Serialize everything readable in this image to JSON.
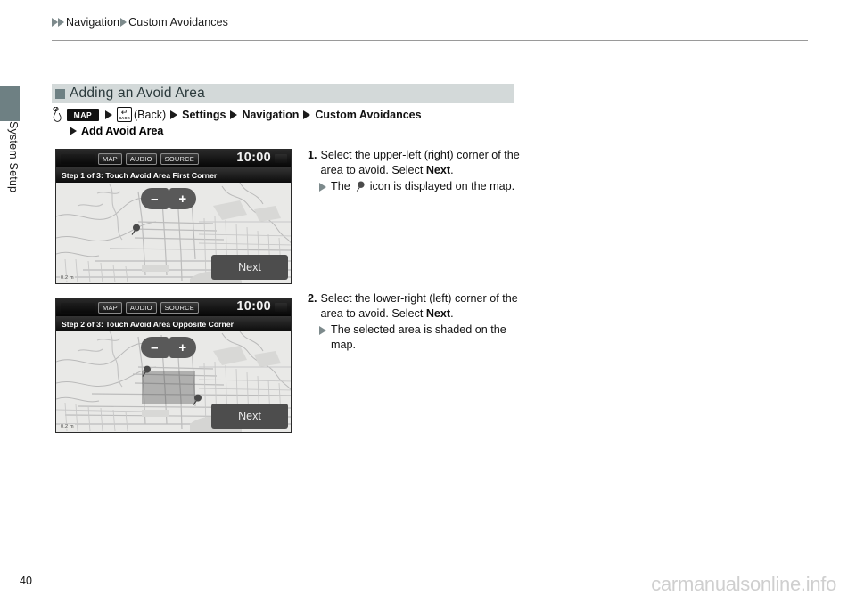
{
  "breadcrumb": {
    "items": [
      "Navigation",
      "Custom Avoidances"
    ]
  },
  "sidebar": {
    "tab_label": "System Setup"
  },
  "section": {
    "heading": "Adding an Avoid Area",
    "accent_color": "#6e8083",
    "background_color": "#d3d9d9"
  },
  "path": {
    "map_key": "MAP",
    "back_key_label": "BACK",
    "back_text": "(Back)",
    "steps": [
      "Settings",
      "Navigation",
      "Custom Avoidances"
    ],
    "final_step": "Add Avoid Area"
  },
  "screens": [
    {
      "name": "step-1",
      "topbar": {
        "buttons": [
          "MAP",
          "AUDIO",
          "SOURCE"
        ],
        "clock": "10:00"
      },
      "step_bar": "Step 1 of 3: Touch Avoid Area First Corner",
      "zoom_out": "–",
      "zoom_in": "+",
      "next_label": "Next",
      "scale": "0.2 m",
      "shaded_area": false
    },
    {
      "name": "step-2",
      "topbar": {
        "buttons": [
          "MAP",
          "AUDIO",
          "SOURCE"
        ],
        "clock": "10:00"
      },
      "step_bar": "Step 2 of 3: Touch Avoid Area Opposite Corner",
      "zoom_out": "–",
      "zoom_in": "+",
      "next_label": "Next",
      "scale": "0.2 m",
      "shaded_area": true
    }
  ],
  "instructions": [
    {
      "number": "1.",
      "text_before": "Select the upper-left (right) corner of the area to avoid. Select ",
      "bold_word": "Next",
      "text_after": ".",
      "sub_before": "The ",
      "sub_after": " icon is displayed on the map."
    },
    {
      "number": "2.",
      "text_before": "Select the lower-right (left) corner of the area to avoid. Select ",
      "bold_word": "Next",
      "text_after": ".",
      "sub_before": "The selected area is shaded on the map.",
      "sub_after": ""
    }
  ],
  "footer": {
    "page_number": "40",
    "watermark": "carmanualsonline.info"
  }
}
